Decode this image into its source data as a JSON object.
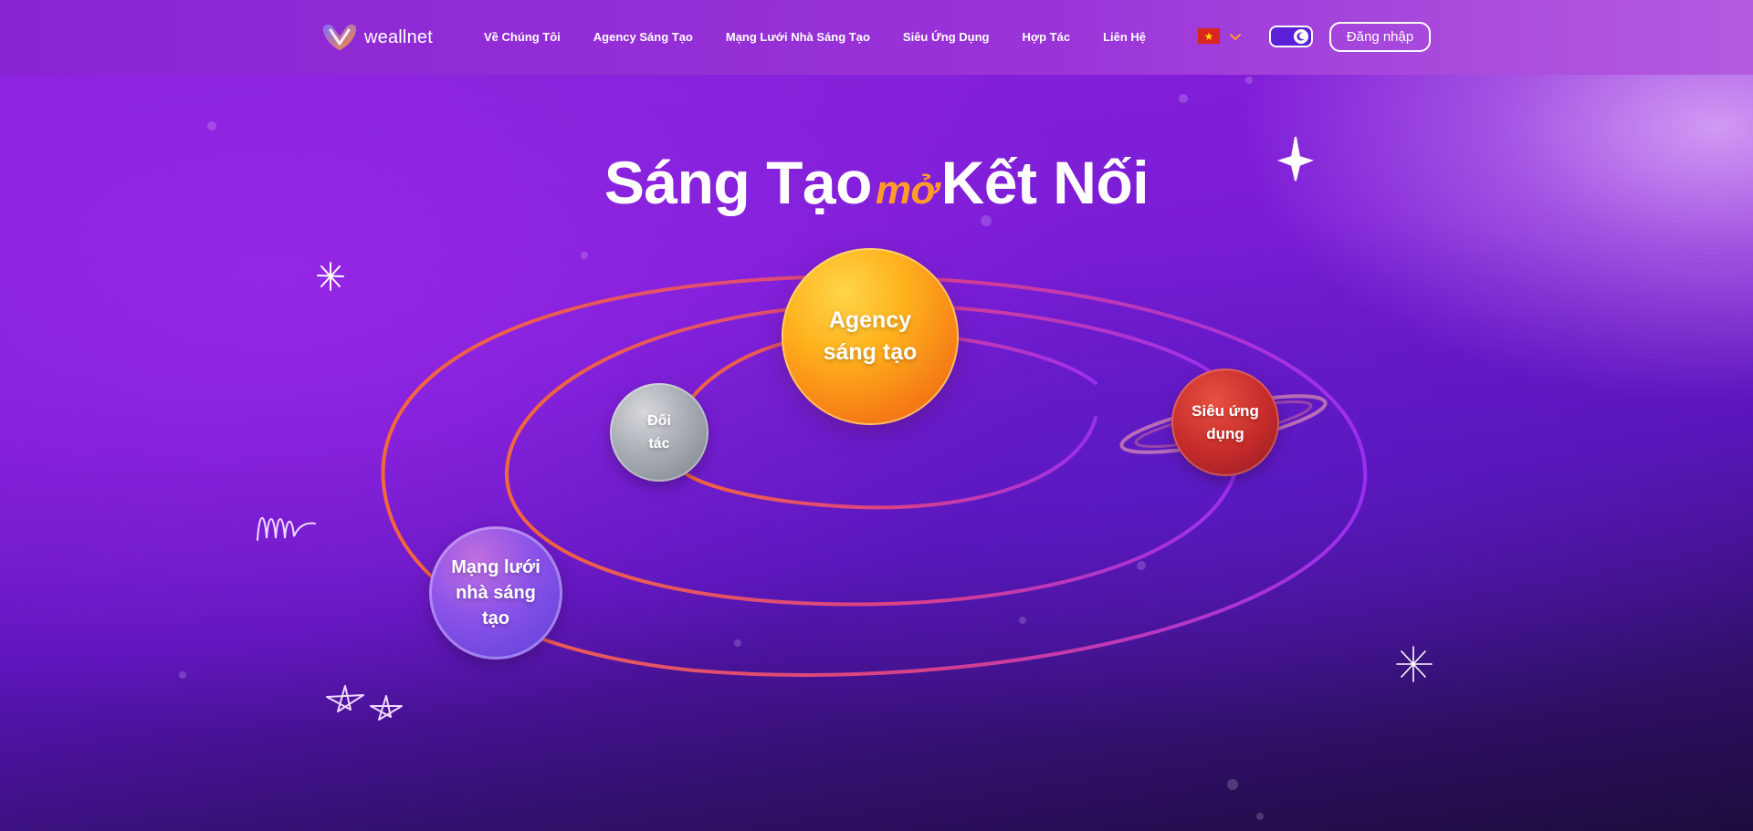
{
  "brand": {
    "name": "weallnet"
  },
  "nav": {
    "items": [
      {
        "label": "Về Chúng Tôi"
      },
      {
        "label": "Agency Sáng Tạo"
      },
      {
        "label": "Mạng Lưới Nhà Sáng Tạo"
      },
      {
        "label": "Siêu Ứng Dụng"
      },
      {
        "label": "Hợp Tác"
      },
      {
        "label": "Liên Hệ"
      }
    ],
    "language_flag": "vietnam-flag-icon",
    "login_label": "Đăng nhập",
    "theme_toggle": {
      "state": "dark",
      "icon": "moon-icon"
    }
  },
  "hero": {
    "title_left": "Sáng Tạo",
    "title_mid": "mở",
    "title_right": "Kết Nối"
  },
  "planets": {
    "agency": [
      "Agency",
      "sáng tạo"
    ],
    "doitac": [
      "Đối",
      "tác"
    ],
    "sieu_ung_dung": [
      "Siêu ứng",
      "dụng"
    ],
    "mang_luoi": [
      "Mạng lưới",
      "nhà sáng",
      "tạo"
    ]
  },
  "colors": {
    "accent_orange": "#ff9a2b",
    "header_bg": "#8a24d3",
    "orbit_start": "#f0643c",
    "orbit_end": "#9a2ef0"
  }
}
